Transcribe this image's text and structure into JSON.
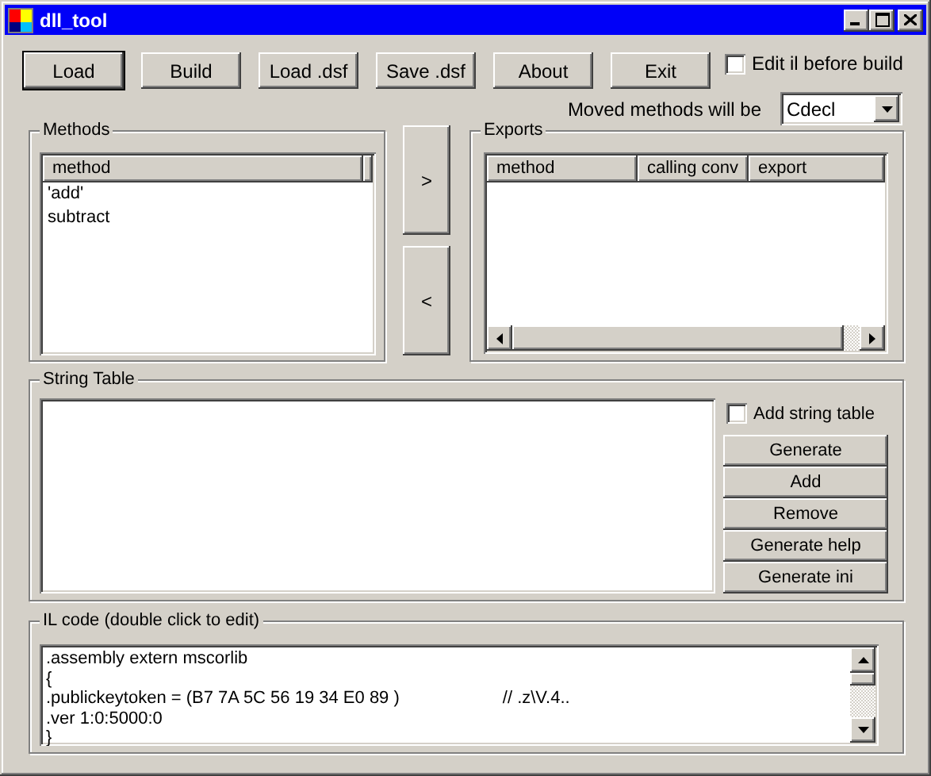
{
  "window": {
    "title": "dll_tool"
  },
  "toolbar_buttons": [
    {
      "label": "Load",
      "default": true
    },
    {
      "label": "Build",
      "default": false
    },
    {
      "label": "Load .dsf",
      "default": false
    },
    {
      "label": "Save .dsf",
      "default": false
    },
    {
      "label": "About",
      "default": false
    },
    {
      "label": "Exit",
      "default": false
    }
  ],
  "edit_il_checkbox": {
    "label": "Edit il before build",
    "checked": false
  },
  "calling_convention": {
    "label": "Moved methods will be",
    "value": "Cdecl"
  },
  "methods": {
    "title": "Methods",
    "columns": [
      "method"
    ],
    "rows": [
      "'add'",
      "subtract"
    ]
  },
  "move_buttons": [
    {
      "label": ">"
    },
    {
      "label": "<"
    }
  ],
  "exports": {
    "title": "Exports",
    "columns": [
      "method",
      "calling conv",
      "export"
    ]
  },
  "string_table": {
    "title": "String Table",
    "checkbox": {
      "label": "Add string table",
      "checked": false
    },
    "buttons": [
      "Generate",
      "Add",
      "Remove",
      "Generate help",
      "Generate ini"
    ]
  },
  "il_code": {
    "title": "IL code (double click to edit)",
    "lines": [
      {
        "code": ".assembly extern mscorlib"
      },
      {
        "code": "{"
      },
      {
        "code": ".publickeytoken = (B7 7A 5C 56 19 34 E0 89 )",
        "comment": "// .z\\V.4.."
      },
      {
        "code": ".ver 1:0:5000:0"
      },
      {
        "code": "}"
      }
    ]
  }
}
